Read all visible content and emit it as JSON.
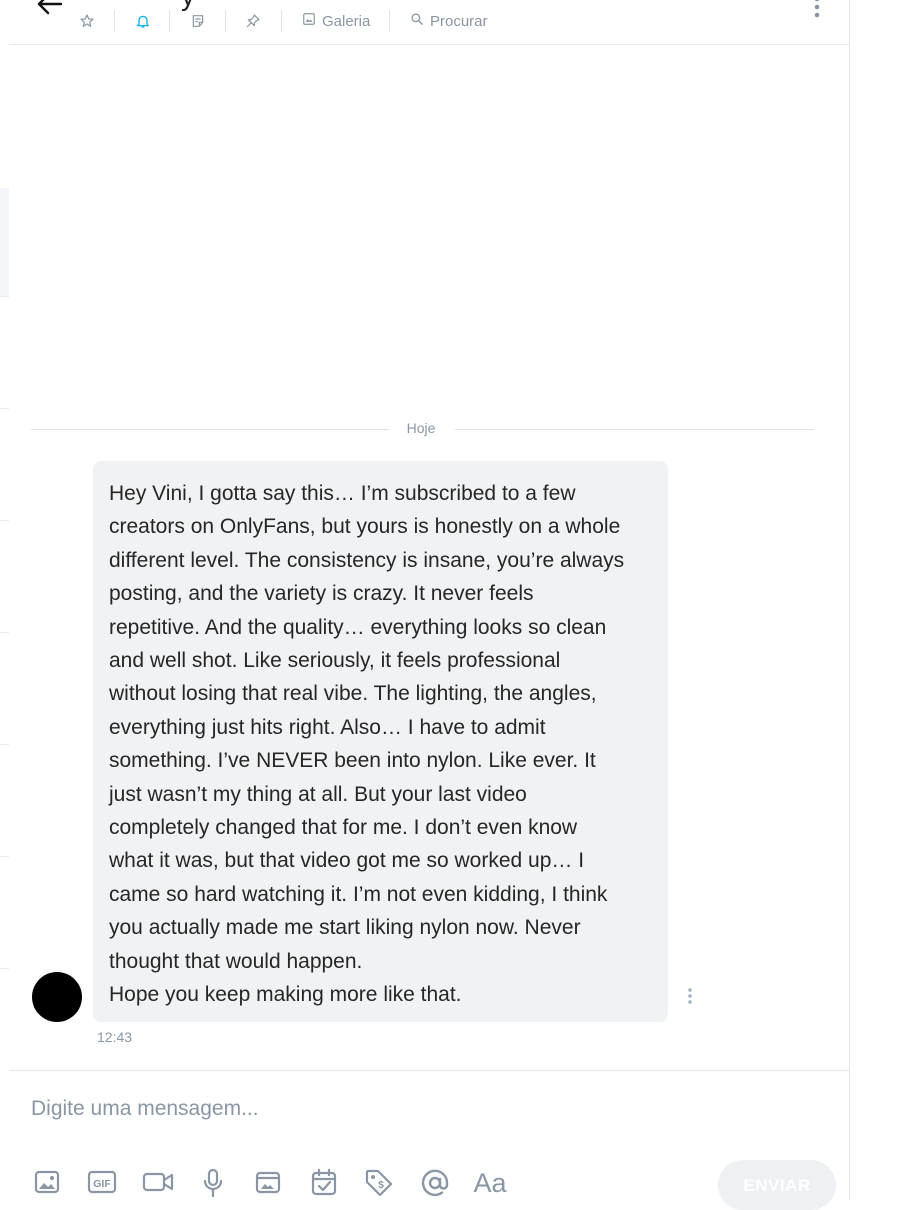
{
  "header": {
    "title_fragment": "y",
    "gallery_label": "Galeria",
    "search_label": "Procurar",
    "icons": [
      "back-arrow-icon",
      "star-icon",
      "bell-icon",
      "note-icon",
      "pin-icon",
      "gallery-icon",
      "search-icon",
      "more-vertical-icon"
    ],
    "active_color": "#00aff0"
  },
  "chat": {
    "date_divider": "Hoje",
    "message": {
      "lines": [
        "Hey Vini, I gotta say this… I’m subscribed to a few",
        "creators on OnlyFans, but yours is honestly on a whole",
        "different level. The consistency is insane, you’re always",
        "posting, and the variety is crazy. It never feels",
        "repetitive. And the quality… everything looks so clean",
        "and well shot. Like seriously, it feels professional",
        "without losing that real vibe. The lighting, the angles,",
        "everything just hits right. Also… I have to admit",
        "something. I’ve NEVER been into nylon. Like ever. It",
        "just wasn’t my thing at all. But your last video",
        "completely changed that for me. I don’t even know",
        "what it was, but that video got me so worked up… I",
        "came so hard watching it. I’m not even kidding, I think",
        "you actually made me start liking nylon now. Never",
        "thought that would happen.",
        "Hope you keep making more like that."
      ],
      "time": "12:43"
    }
  },
  "composer": {
    "placeholder": "Digite uma mensagem...",
    "gif_label": "GIF",
    "font_label": "Aa",
    "send_label": "ENVIAR",
    "toolbar_icons": [
      "image-icon",
      "gif-icon",
      "video-icon",
      "microphone-icon",
      "vault-icon",
      "schedule-icon",
      "price-tag-icon",
      "mention-icon",
      "text-format-icon"
    ]
  }
}
